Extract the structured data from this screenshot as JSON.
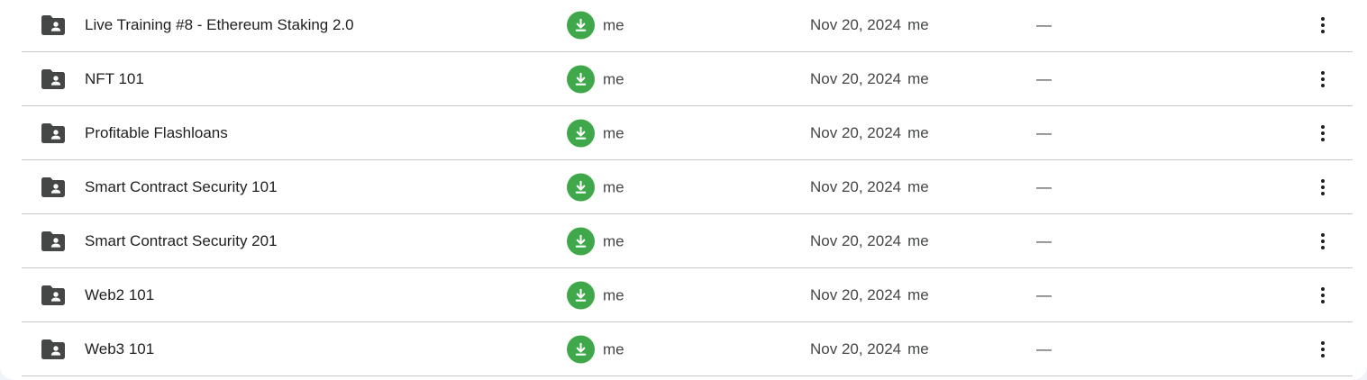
{
  "file_list": {
    "rows": [
      {
        "name": "Live Training #8 - Ethereum Staking 2.0",
        "owner": "me",
        "modified_date": "Nov 20, 2024",
        "modified_by": "me",
        "size": "—"
      },
      {
        "name": "NFT 101",
        "owner": "me",
        "modified_date": "Nov 20, 2024",
        "modified_by": "me",
        "size": "—"
      },
      {
        "name": "Profitable Flashloans",
        "owner": "me",
        "modified_date": "Nov 20, 2024",
        "modified_by": "me",
        "size": "—"
      },
      {
        "name": "Smart Contract Security 101",
        "owner": "me",
        "modified_date": "Nov 20, 2024",
        "modified_by": "me",
        "size": "—"
      },
      {
        "name": "Smart Contract Security 201",
        "owner": "me",
        "modified_date": "Nov 20, 2024",
        "modified_by": "me",
        "size": "—"
      },
      {
        "name": "Web2 101",
        "owner": "me",
        "modified_date": "Nov 20, 2024",
        "modified_by": "me",
        "size": "—"
      },
      {
        "name": "Web3 101",
        "owner": "me",
        "modified_date": "Nov 20, 2024",
        "modified_by": "me",
        "size": "—"
      }
    ]
  },
  "icons": {
    "folder": "shared-folder-icon",
    "owner_badge": "download-offline-icon",
    "more": "more-vert-icon"
  },
  "colors": {
    "folder_icon": "#444746",
    "offline_badge": "#3fa84a",
    "divider": "#c7c7c7",
    "text_primary": "#1f1f1f",
    "text_secondary": "#444746"
  }
}
